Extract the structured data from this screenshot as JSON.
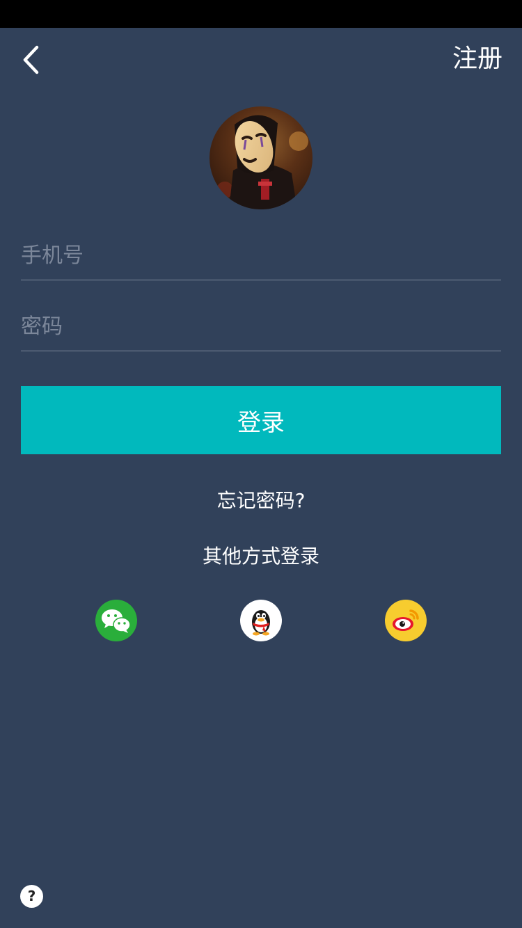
{
  "header": {
    "back_icon": "chevron-left-icon",
    "register_label": "注册"
  },
  "form": {
    "phone_placeholder": "手机号",
    "phone_value": "",
    "password_placeholder": "密码",
    "password_value": "",
    "login_label": "登录"
  },
  "links": {
    "forgot_password": "忘记密码?",
    "other_login": "其他方式登录"
  },
  "social": [
    {
      "icon": "wechat-icon",
      "color": "#2aae3b"
    },
    {
      "icon": "qq-icon",
      "color": "#ffffff"
    },
    {
      "icon": "weibo-icon",
      "color": "#f7cc2f"
    }
  ],
  "help": {
    "label": "?"
  },
  "colors": {
    "background": "#31415a",
    "accent": "#01b9bd",
    "status_bar": "#000000"
  }
}
